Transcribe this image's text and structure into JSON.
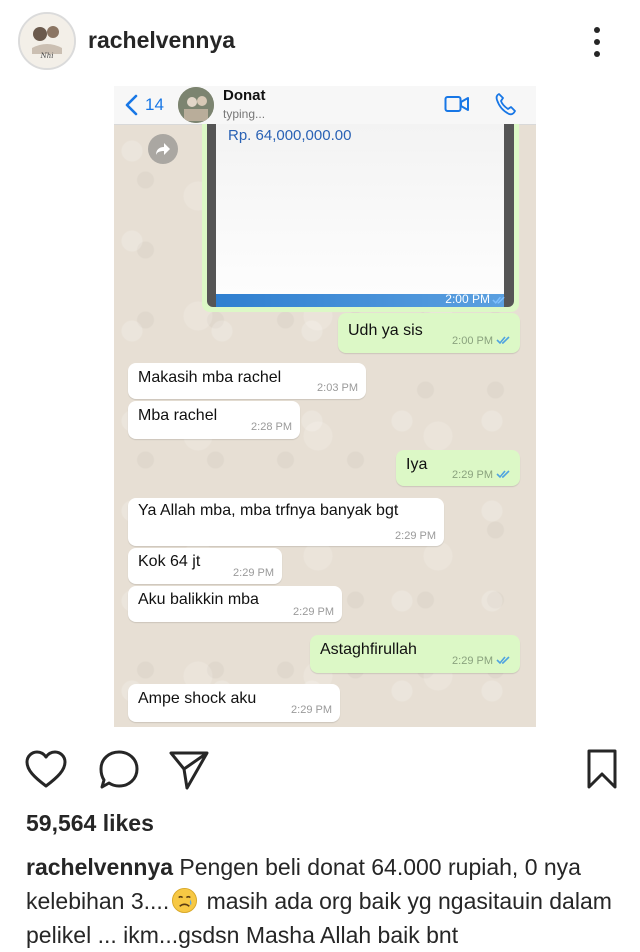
{
  "post": {
    "username": "rachelvennya",
    "likes": "59,564 likes",
    "caption_user": "rachelvennya",
    "caption_text_1": "Pengen beli donat 64.000 rupiah, 0 nya kelebihan 3....",
    "caption_emoji": "crying-face-icon",
    "caption_text_2": "masih ada org baik yg ngasitauin dalam pelikel ... ikm...gsdsn Masha Allah baik bnt"
  },
  "whatsapp": {
    "back_count": "14",
    "contact_name": "Donat",
    "contact_status": "typing...",
    "image_amount": "Rp. 64,000,000.00",
    "image_time": "2:00 PM",
    "messages": [
      {
        "dir": "out",
        "text": "Udh ya sis",
        "time": "2:00 PM"
      },
      {
        "dir": "in",
        "text": "Makasih mba rachel",
        "time": "2:03 PM"
      },
      {
        "dir": "in",
        "text": "Mba rachel",
        "time": "2:28 PM"
      },
      {
        "dir": "out",
        "text": "Iya",
        "time": "2:29 PM"
      },
      {
        "dir": "in",
        "text": "Ya Allah mba, mba trfnya banyak bgt",
        "time": "2:29 PM"
      },
      {
        "dir": "in",
        "text": "Kok 64 jt",
        "time": "2:29 PM"
      },
      {
        "dir": "in",
        "text": "Aku balikkin mba",
        "time": "2:29 PM"
      },
      {
        "dir": "out",
        "text": "Astaghfirullah",
        "time": "2:29 PM"
      },
      {
        "dir": "in",
        "text": "Ampe shock aku",
        "time": "2:29 PM"
      }
    ]
  },
  "colors": {
    "wa_out": "#dcf8c6",
    "wa_in": "#ffffff",
    "ios_blue": "#1877e6",
    "read_tick": "#4fa3e0"
  }
}
